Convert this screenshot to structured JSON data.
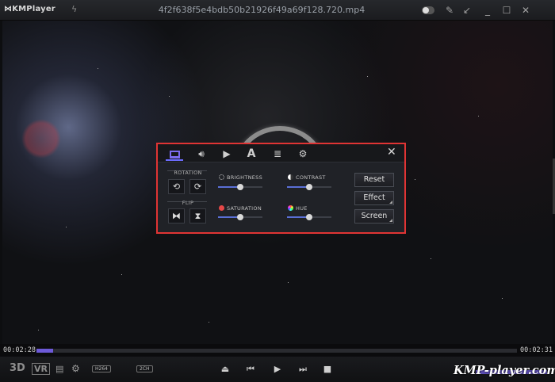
{
  "app": {
    "name": "KMPlayer",
    "filename": "4f2f638f5e4bdb50b21926f49a69f128.720.mp4"
  },
  "titlebar_icons": [
    "bolt-icon",
    "pin-icon",
    "shrink-icon",
    "minimize-icon",
    "maximize-icon",
    "close-icon"
  ],
  "panel": {
    "tabs": [
      "screen-icon",
      "audio-icon",
      "play-icon",
      "subtitle-icon",
      "playlist-icon",
      "settings-icon"
    ],
    "tab_subtitle_glyph": "A",
    "close_glyph": "✕",
    "rotation_label": "ROTATION",
    "flip_label": "FLIP",
    "sliders": [
      {
        "label": "BRIGHTNESS",
        "value": 0.5
      },
      {
        "label": "CONTRAST",
        "value": 0.5
      },
      {
        "label": "SATURATION",
        "value": 0.5
      },
      {
        "label": "HUE",
        "value": 0.5
      }
    ],
    "reset": "Reset",
    "effect": "Effect",
    "screen": "Screen"
  },
  "playback": {
    "elapsed": "00:02:28",
    "total": "00:02:31",
    "progress": 0.035
  },
  "bottom": {
    "three_d": "3D",
    "vr": "VR",
    "codec": "H264",
    "channels": "2CH"
  },
  "watermark": "KMP-player.com",
  "colors": {
    "accent": "#6d5ad8",
    "highlight_border": "#e03434"
  }
}
